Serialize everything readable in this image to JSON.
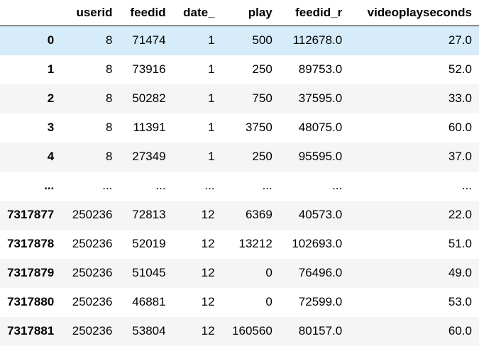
{
  "table": {
    "columns": [
      "userid",
      "feedid",
      "date_",
      "play",
      "feedid_r",
      "videoplayseconds"
    ],
    "rows": [
      {
        "index": "0",
        "cells": [
          "8",
          "71474",
          "1",
          "500",
          "112678.0",
          "27.0"
        ]
      },
      {
        "index": "1",
        "cells": [
          "8",
          "73916",
          "1",
          "250",
          "89753.0",
          "52.0"
        ]
      },
      {
        "index": "2",
        "cells": [
          "8",
          "50282",
          "1",
          "750",
          "37595.0",
          "33.0"
        ]
      },
      {
        "index": "3",
        "cells": [
          "8",
          "11391",
          "1",
          "3750",
          "48075.0",
          "60.0"
        ]
      },
      {
        "index": "4",
        "cells": [
          "8",
          "27349",
          "1",
          "250",
          "95595.0",
          "37.0"
        ]
      },
      {
        "index": "...",
        "cells": [
          "...",
          "...",
          "...",
          "...",
          "...",
          "..."
        ]
      },
      {
        "index": "7317877",
        "cells": [
          "250236",
          "72813",
          "12",
          "6369",
          "40573.0",
          "22.0"
        ]
      },
      {
        "index": "7317878",
        "cells": [
          "250236",
          "52019",
          "12",
          "13212",
          "102693.0",
          "51.0"
        ]
      },
      {
        "index": "7317879",
        "cells": [
          "250236",
          "51045",
          "12",
          "0",
          "76496.0",
          "49.0"
        ]
      },
      {
        "index": "7317880",
        "cells": [
          "250236",
          "46881",
          "12",
          "0",
          "72599.0",
          "53.0"
        ]
      },
      {
        "index": "7317881",
        "cells": [
          "250236",
          "53804",
          "12",
          "160560",
          "80157.0",
          "60.0"
        ]
      }
    ]
  },
  "colors": {
    "highlight_row": "#d6ecfa",
    "striped_row": "#f5f5f5",
    "header_border": "#000000"
  }
}
